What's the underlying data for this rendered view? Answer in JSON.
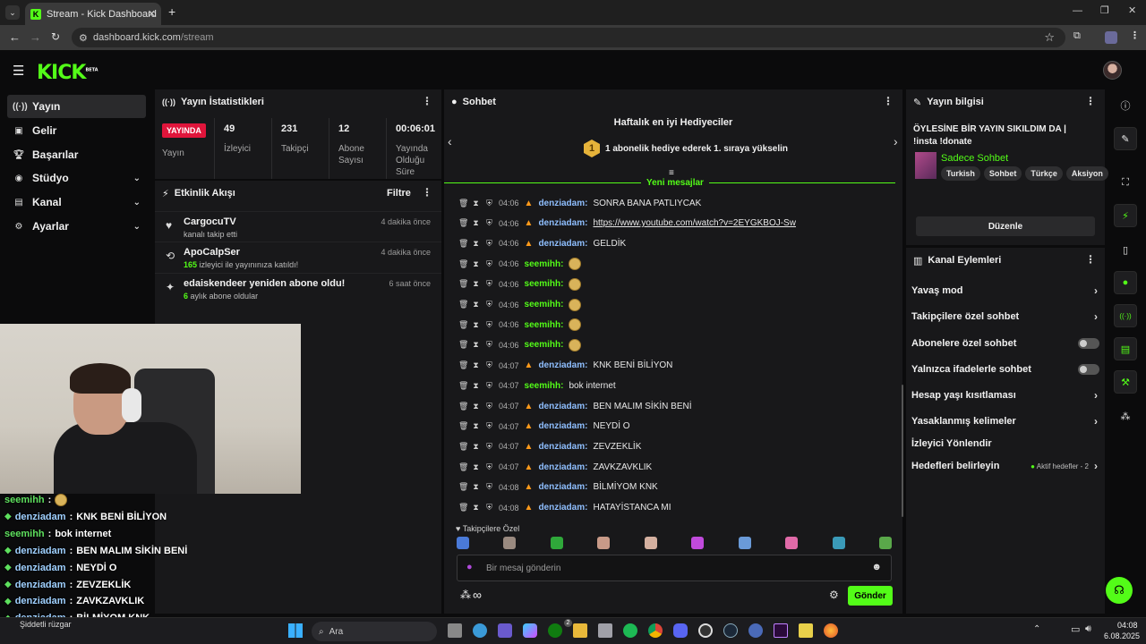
{
  "browser": {
    "tab_title": "Stream - Kick Dashboard",
    "url_host": "dashboard.kick.com",
    "url_path": "/stream"
  },
  "app": {
    "logo": "KICK",
    "logo_badge": "BETA"
  },
  "sidebar": {
    "items": [
      {
        "label": "Yayın",
        "icon": "broadcast-icon"
      },
      {
        "label": "Gelir",
        "icon": "revenue-icon"
      },
      {
        "label": "Başarılar",
        "icon": "trophy-icon"
      },
      {
        "label": "Stüdyo",
        "icon": "studio-icon"
      },
      {
        "label": "Kanal",
        "icon": "channel-icon"
      },
      {
        "label": "Ayarlar",
        "icon": "gear-icon"
      }
    ]
  },
  "stats": {
    "title": "Yayın İstatistikleri",
    "live_badge": "YAYINDA",
    "live_label": "Yayın",
    "viewers": {
      "value": "49",
      "label": "İzleyici"
    },
    "followers": {
      "value": "231",
      "label": "Takipçi"
    },
    "subs": {
      "value": "12",
      "label": "Abone Sayısı"
    },
    "uptime": {
      "value": "00:06:01",
      "label": "Yayında Olduğu Süre"
    }
  },
  "activity": {
    "title": "Etkinlik Akışı",
    "filter": "Filtre",
    "items": [
      {
        "title": "CargocuTV",
        "sub_num": "",
        "sub": "kanalı takip etti",
        "time": "4 dakika önce"
      },
      {
        "title": "ApoCalpSer",
        "sub_num": "165",
        "sub": " izleyici ile yayınınıza katıldı!",
        "time": "4 dakika önce"
      },
      {
        "title": "edaiskendeer yeniden abone oldu!",
        "sub_num": "6",
        "sub": " aylık abone oldular",
        "time": "6 saat önce"
      }
    ]
  },
  "chat": {
    "title": "Sohbet",
    "gifters_title": "Haftalık en iyi Hediyeciler",
    "gifters_rank": "1",
    "gifters_text": "1 abonelik hediye ederek 1. sıraya yükselin",
    "new_messages": "Yeni mesajlar",
    "messages": [
      {
        "time": "04:06",
        "user": "denziadam",
        "text": "SONRA BANA PATLIYCAK"
      },
      {
        "time": "04:06",
        "user": "denziadam",
        "text": "https://www.youtube.com/watch?v=2EYGKBOJ-Sw"
      },
      {
        "time": "04:06",
        "user": "denziadam",
        "text": "GELDİK"
      },
      {
        "time": "04:06",
        "user": "seemihh",
        "text": ""
      },
      {
        "time": "04:06",
        "user": "seemihh",
        "text": ""
      },
      {
        "time": "04:06",
        "user": "seemihh",
        "text": ""
      },
      {
        "time": "04:06",
        "user": "seemihh",
        "text": ""
      },
      {
        "time": "04:06",
        "user": "seemihh",
        "text": ""
      },
      {
        "time": "04:07",
        "user": "denziadam",
        "text": "KNK BENİ BİLİYON"
      },
      {
        "time": "04:07",
        "user": "seemihh",
        "text": "bok internet"
      },
      {
        "time": "04:07",
        "user": "denziadam",
        "text": "BEN MALIM SİKİN BENİ"
      },
      {
        "time": "04:07",
        "user": "denziadam",
        "text": "NEYDİ O"
      },
      {
        "time": "04:07",
        "user": "denziadam",
        "text": "ZEVZEKLİK"
      },
      {
        "time": "04:07",
        "user": "denziadam",
        "text": "ZAVKZAVKLIK"
      },
      {
        "time": "04:08",
        "user": "denziadam",
        "text": "BİLMİYOM KNK"
      },
      {
        "time": "04:08",
        "user": "denziadam",
        "text": "HATAYİSTANCA MI"
      }
    ],
    "followers_only": "Takipçilere Özel",
    "input_placeholder": "Bir mesaj gönderin",
    "infinity": "∞",
    "send": "Gönder"
  },
  "stream_info": {
    "title": "Yayın bilgisi",
    "stream_title": "ÖYLESİNE BİR YAYIN SIKILDIM DA | !insta !donate",
    "category": "Sadece Sohbet",
    "tags": [
      "Turkish",
      "Sohbet",
      "Türkçe",
      "Aksiyon"
    ],
    "edit": "Düzenle"
  },
  "actions": {
    "title": "Kanal Eylemleri",
    "rows": [
      {
        "label": "Yavaş mod",
        "type": "chevron"
      },
      {
        "label": "Takipçilere özel sohbet",
        "type": "chevron"
      },
      {
        "label": "Abonelere özel sohbet",
        "type": "toggle"
      },
      {
        "label": "Yalnızca ifadelerle sohbet",
        "type": "toggle"
      },
      {
        "label": "Hesap yaşı kısıtlaması",
        "type": "chevron"
      },
      {
        "label": "Yasaklanmış kelimeler",
        "type": "chevron"
      },
      {
        "label": "İzleyici Yönlendir",
        "type": "none"
      },
      {
        "label": "Hedefleri belirleyin",
        "type": "chevron"
      }
    ],
    "goals_status": "Aktif hedefler - 2"
  },
  "overlay": {
    "lines": [
      {
        "user": "seemihh",
        "text": ""
      },
      {
        "user": "denziadam",
        "text": "KNK BENİ BİLİYON"
      },
      {
        "user": "seemihh",
        "text": "bok internet"
      },
      {
        "user": "denziadam",
        "text": "BEN MALIM SİKİN BENİ"
      },
      {
        "user": "denziadam",
        "text": "NEYDİ O"
      },
      {
        "user": "denziadam",
        "text": "ZEVZEKLİK"
      },
      {
        "user": "denziadam",
        "text": "ZAVKZAVKLIK"
      },
      {
        "user": "denziadam",
        "text": "BİLMİYOM KNK"
      },
      {
        "user": "denziadam",
        "text": "HATAYİSTANCA MI"
      }
    ]
  },
  "taskbar": {
    "weather": "Şiddetli rüzgar",
    "search": "Ara",
    "time": "04:08",
    "date": "6.08.2025",
    "notif_count": "2"
  }
}
